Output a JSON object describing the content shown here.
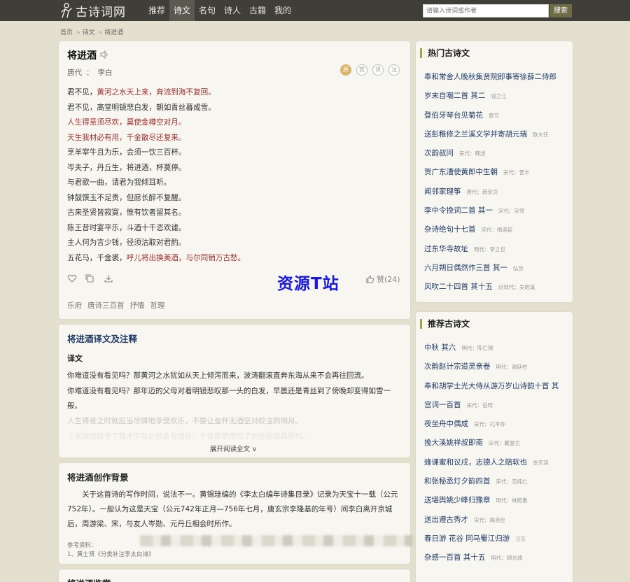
{
  "site": {
    "name": "古诗词网"
  },
  "nav": [
    {
      "label": "推荐"
    },
    {
      "label": "诗文"
    },
    {
      "label": "名句"
    },
    {
      "label": "诗人"
    },
    {
      "label": "古籍"
    },
    {
      "label": "我的"
    }
  ],
  "search": {
    "placeholder": "请输入诗词或作者",
    "button": "搜索"
  },
  "breadcrumb": [
    "首页",
    "诗文",
    "将进酒"
  ],
  "poem": {
    "title": "将进酒",
    "dynasty": "唐代",
    "colon": "：",
    "author": "李白",
    "modes": [
      "原",
      "赏",
      "译",
      "注"
    ],
    "lines": [
      {
        "a": "君不见，",
        "b": "黄河之水天上来，奔流到海不复回。",
        "c": ""
      },
      {
        "a": "君不见，高堂明镜悲白发，朝如青丝暮成雪。",
        "b": "",
        "c": ""
      },
      {
        "a": "",
        "b": "人生得意须尽欢，莫使金樽空对月。",
        "c": ""
      },
      {
        "a": "",
        "b": "天生我材必有用，千金散尽还复来。",
        "c": ""
      },
      {
        "a": "烹羊宰牛且为乐，会须一饮三百杯。",
        "b": "",
        "c": ""
      },
      {
        "a": "岑夫子，丹丘生，将进酒，杯莫停。",
        "b": "",
        "c": ""
      },
      {
        "a": "与君歌一曲，请君为我倾耳听。",
        "b": "",
        "c": ""
      },
      {
        "a": "钟鼓馔玉不足贵，但愿长醉不复醒。",
        "b": "",
        "c": ""
      },
      {
        "a": "古来圣贤皆寂寞，惟有饮者留其名。",
        "b": "",
        "c": ""
      },
      {
        "a": "陈王昔时宴平乐，斗酒十千恣欢谑。",
        "b": "",
        "c": ""
      },
      {
        "a": "主人何为言少钱，径须沽取对君酌。",
        "b": "",
        "c": ""
      },
      {
        "a": "五花马，千金裘，",
        "b": "呼儿将出换美酒，与尔同销万古愁。",
        "c": ""
      }
    ],
    "likes": "赞(24)",
    "watermark": "资源T站",
    "tags": [
      "乐府",
      "唐诗三百首",
      "抒情",
      "哲理"
    ]
  },
  "translation": {
    "title": "将进酒译文及注释",
    "subtitle": "译文",
    "p1": "你难道没有看见吗？那黄河之水犹如从天上倾泻而来，波涛翻滚直奔东海从来不会再往回流。",
    "p2": "你难道没有看见吗？那年迈的父母对着明镜悲叹那一头的白发，早晨还是青丝到了傍晚却变得如雪一般。",
    "p3": "人生得意之时就应当尽情地享受欢乐，不要让金杯无酒空对皎洁的明月。",
    "p4": "上天既然赋予了我才干就必然会有用处，千金即使用尽了也还能够再得到。",
    "expand": "展开阅读全文 ∨"
  },
  "background": {
    "title": "将进酒创作背景",
    "text": "关于这首诗的写作时间，说法不一。黄锡珪编的《李太白编年诗集目录》记录为天宝十一载（公元752年）。一般认为这是天宝（公元742年正月—756年七月，唐玄宗李隆基的年号）间李白离开京城后，周游梁、宋，与友人岑勋、元丹丘相会时所作。",
    "refs_label": "参考资料：",
    "ref1": "1、黄士贤《分类补注李太白诗》"
  },
  "appreciation": {
    "title": "将进酒鉴赏"
  },
  "hot": {
    "title": "热门古诗文",
    "items": [
      {
        "t": "奉和常舍人晚秋集贤院即事寄徐薛二侍郎",
        "d": ""
      },
      {
        "t": "岁末自嘲二首 其二",
        "d": "钱之江"
      },
      {
        "t": "登伯牙琴台见菊花",
        "d": "黄节"
      },
      {
        "t": "送彭稚修之兰溪文学并寄胡元瑞",
        "d": "欧大任"
      },
      {
        "t": "次韵叔问",
        "d": "宋代：韩淲"
      },
      {
        "t": "贺广东漕使黄郎中生朝",
        "d": "宋代：曾丰"
      },
      {
        "t": "闻邻家理筝",
        "d": "唐代：薛安贞"
      },
      {
        "t": "李中令挽词二首 其一",
        "d": "宋代：宋祁"
      },
      {
        "t": "杂诗绝句十七首",
        "d": "宋代：梅尧臣"
      },
      {
        "t": "过东华寺故址",
        "d": "明代：李之世"
      },
      {
        "t": "六月朔日偶然作三首 其一",
        "d": "弘历"
      },
      {
        "t": "风吹二十四首 其十五",
        "d": "近现代：吴昭溪"
      }
    ]
  },
  "recommend": {
    "title": "推荐古诗文",
    "items": [
      {
        "t": "中秋 其六",
        "d": "明代：陈仁锡"
      },
      {
        "t": "次韵赵计宗道灵亲卷",
        "d": "明代：谢廷柱"
      },
      {
        "t": "奉和胡学士光大侍从游万岁山诗韵十首 其",
        "d": ""
      },
      {
        "t": "宫词一百首",
        "d": "宋代：岳珂"
      },
      {
        "t": "夜坐舟中偶成",
        "d": "宋代：孔平仲"
      },
      {
        "t": "挽大溪姚祥叔即南",
        "d": "宋代：戴复古"
      },
      {
        "t": "蜂课蜜和议戌，志德人之赔软也",
        "d": "金天羽"
      },
      {
        "t": "和张秘丞灯夕韵四首",
        "d": "宋代：范纯仁"
      },
      {
        "t": "送堪舆姚少峰归豫章",
        "d": "明代：林熙春"
      },
      {
        "t": "送出遵古秀才",
        "d": "宋代：梅尧臣"
      },
      {
        "t": "春日游 花谷 同马蜀江归游",
        "d": "汪东"
      },
      {
        "t": "杂感一百首 其十五",
        "d": "明代：顾允成"
      }
    ]
  }
}
